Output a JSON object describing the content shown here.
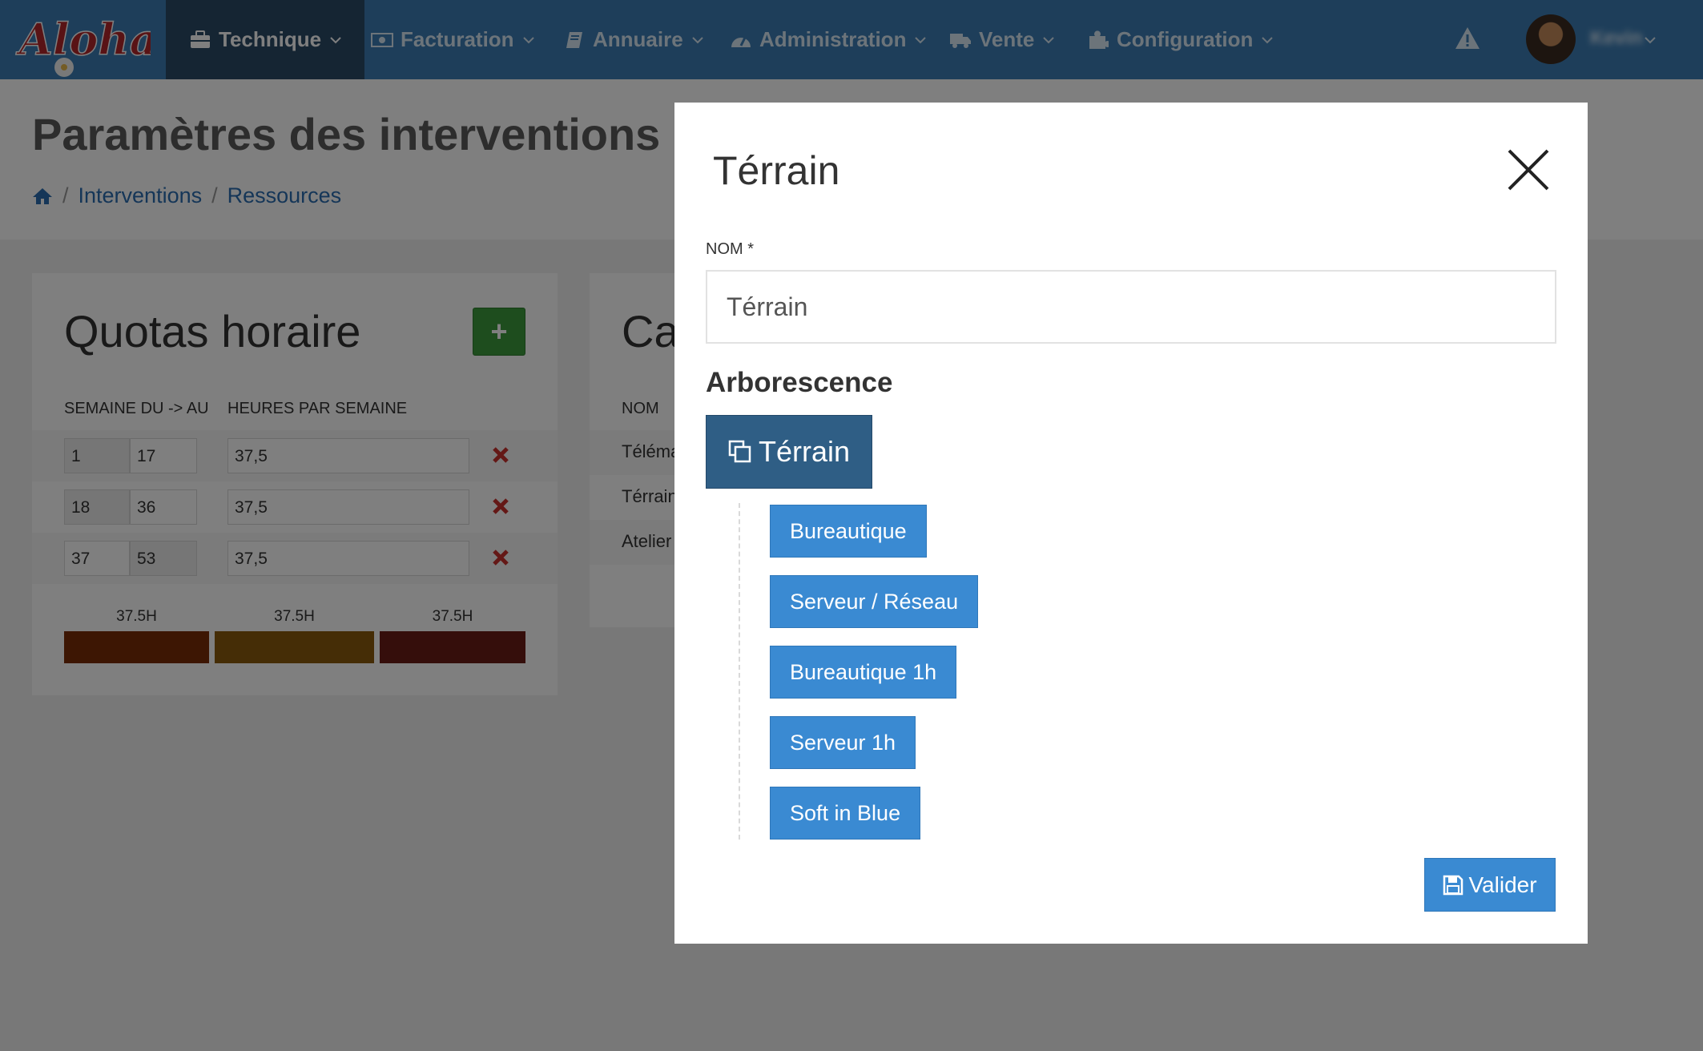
{
  "nav": {
    "logo_text": "Aloha",
    "items": [
      {
        "label": "Technique",
        "icon": "briefcase-icon"
      },
      {
        "label": "Facturation",
        "icon": "money-icon"
      },
      {
        "label": "Annuaire",
        "icon": "book-icon"
      },
      {
        "label": "Administration",
        "icon": "dashboard-icon"
      },
      {
        "label": "Vente",
        "icon": "truck-icon"
      },
      {
        "label": "Configuration",
        "icon": "puzzle-icon"
      }
    ],
    "active_index": 0,
    "user_name": "Kevin",
    "colors": {
      "bar": "#3c7db5",
      "active": "#2b4a66"
    }
  },
  "page": {
    "title": "Paramètres des interventions",
    "breadcrumb": [
      "Interventions",
      "Ressources"
    ]
  },
  "quotas": {
    "title": "Quotas horaire",
    "add_label": "+",
    "headers": [
      "SEMAINE DU -> AU",
      "HEURES PAR SEMAINE"
    ],
    "rows": [
      {
        "from": "1",
        "to": "17",
        "hours": "37,5"
      },
      {
        "from": "18",
        "to": "36",
        "hours": "37,5"
      },
      {
        "from": "37",
        "to": "53",
        "hours": "37,5"
      }
    ],
    "bars": [
      {
        "label": "37.5H",
        "color": "#7a2c06"
      },
      {
        "label": "37.5H",
        "color": "#8a5a0c"
      },
      {
        "label": "37.5H",
        "color": "#6b1c17"
      }
    ]
  },
  "categories": {
    "title": "Ca",
    "header": "NOM",
    "rows": [
      "Téléma",
      "Térrain",
      "Atelier"
    ]
  },
  "modal": {
    "title": "Térrain",
    "field_label": "NOM *",
    "name_value": "Térrain",
    "tree_title": "Arborescence",
    "root_label": "Térrain",
    "children": [
      "Bureautique",
      "Serveur / Réseau",
      "Bureautique 1h",
      "Serveur 1h",
      "Soft in Blue"
    ],
    "save_label": "Valider",
    "colors": {
      "root": "#2f5e85",
      "child": "#3a8ad2"
    }
  }
}
